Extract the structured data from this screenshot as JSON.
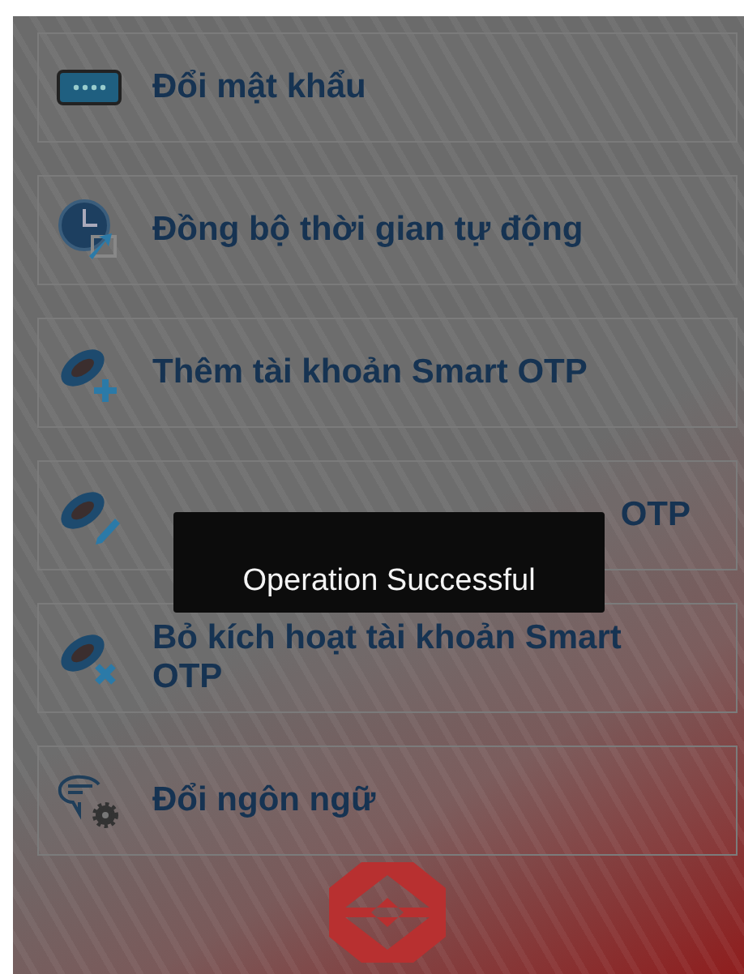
{
  "menu": {
    "items": [
      {
        "kind": "password",
        "label": "Đổi mật khẩu",
        "obscured": false
      },
      {
        "kind": "clock-sync",
        "label": "Đồng bộ thời gian tự động",
        "obscured": false
      },
      {
        "kind": "token-add",
        "label": "Thêm tài khoản Smart OTP",
        "obscured": false
      },
      {
        "kind": "token-edit",
        "label": "OTP",
        "obscured": true
      },
      {
        "kind": "token-remove",
        "label": "Bỏ kích hoạt tài khoản Smart OTP",
        "obscured": false
      },
      {
        "kind": "language",
        "label": "Đổi ngôn ngữ",
        "obscured": false
      }
    ]
  },
  "toast": {
    "message": "Operation Successful"
  }
}
